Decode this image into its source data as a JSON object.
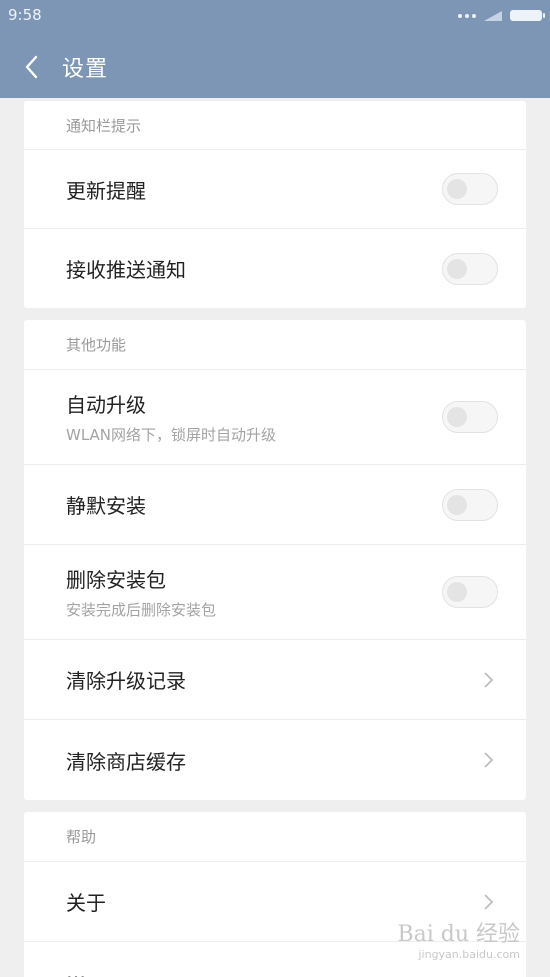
{
  "status_bar": {
    "time": "9:58"
  },
  "header": {
    "title": "设置"
  },
  "sections": [
    {
      "title": "通知栏提示",
      "rows": [
        {
          "label": "更新提醒",
          "sub": "",
          "control": "toggle",
          "on": false
        },
        {
          "label": "接收推送通知",
          "sub": "",
          "control": "toggle",
          "on": false
        }
      ]
    },
    {
      "title": "其他功能",
      "rows": [
        {
          "label": "自动升级",
          "sub": "WLAN网络下，锁屏时自动升级",
          "control": "toggle",
          "on": false
        },
        {
          "label": "静默安装",
          "sub": "",
          "control": "toggle",
          "on": false
        },
        {
          "label": "删除安装包",
          "sub": "安装完成后删除安装包",
          "control": "toggle",
          "on": false
        },
        {
          "label": "清除升级记录",
          "sub": "",
          "control": "chevron"
        },
        {
          "label": "清除商店缓存",
          "sub": "",
          "control": "chevron"
        }
      ]
    },
    {
      "title": "帮助",
      "rows": [
        {
          "label": "关于",
          "sub": "",
          "control": "chevron"
        }
      ]
    }
  ],
  "partial_row": "…",
  "watermark": {
    "main": "Bai du 经验",
    "sub": "jingyan.baidu.com"
  },
  "colors": {
    "header_bg": "#7e96b6",
    "page_bg": "#efefef",
    "card_bg": "#ffffff"
  }
}
